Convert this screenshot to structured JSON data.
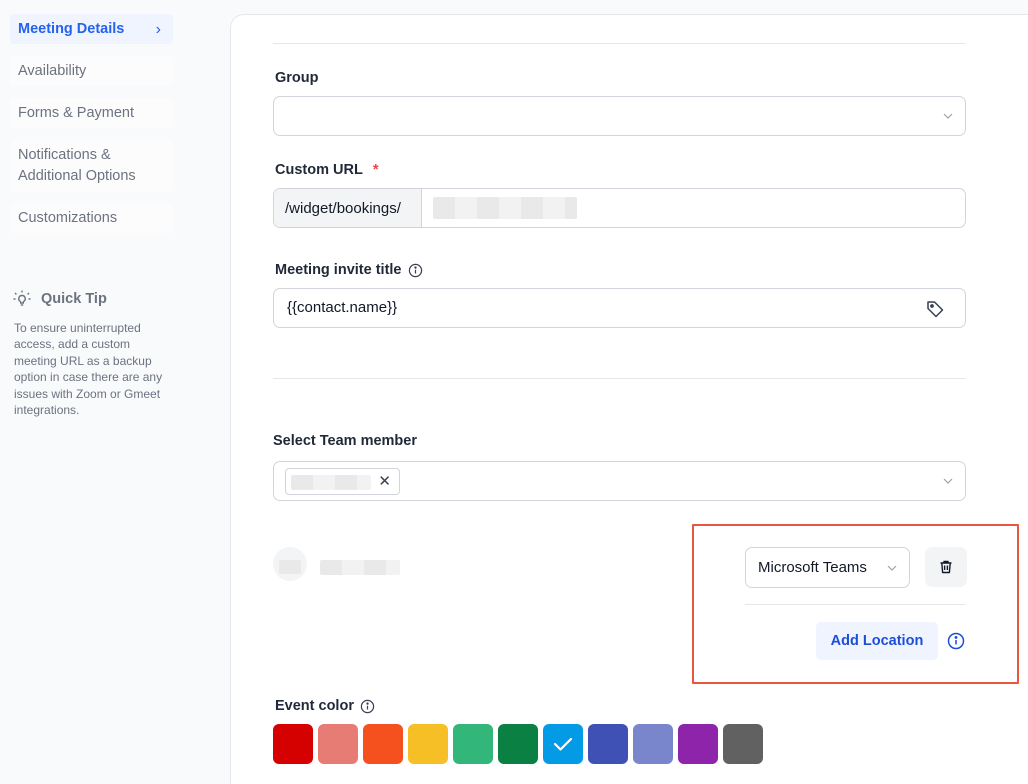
{
  "sidebar": {
    "items": [
      {
        "label": "Meeting Details",
        "active": true
      },
      {
        "label": "Availability",
        "active": false
      },
      {
        "label": "Forms & Payment",
        "active": false
      },
      {
        "label": "Notifications & Additional Options",
        "active": false
      },
      {
        "label": "Customizations",
        "active": false
      }
    ],
    "tip_title": "Quick Tip",
    "tip_text": "To ensure uninterrupted access, add a custom meeting URL as a backup option in case there are any issues with Zoom or Gmeet integrations."
  },
  "form": {
    "group_label": "Group",
    "group_value": "",
    "custom_url_label": "Custom URL",
    "custom_url_required": "*",
    "custom_url_prefix": "/widget/bookings/",
    "invite_title_label": "Meeting invite title",
    "invite_title_value": "{{contact.name}}",
    "team_member_label": "Select Team member",
    "location": {
      "selected": "Microsoft Teams",
      "add_button": "Add Location"
    },
    "event_color_label": "Event color",
    "colors": [
      "#d50000",
      "#e67c73",
      "#f4511e",
      "#f6bf26",
      "#33b679",
      "#0b8043",
      "#039be5",
      "#3f51b5",
      "#7986cb",
      "#8e24aa",
      "#616161"
    ],
    "selected_color_index": 6
  },
  "theme": {
    "accent": "#2563eb",
    "highlight_border": "#e8573d"
  }
}
